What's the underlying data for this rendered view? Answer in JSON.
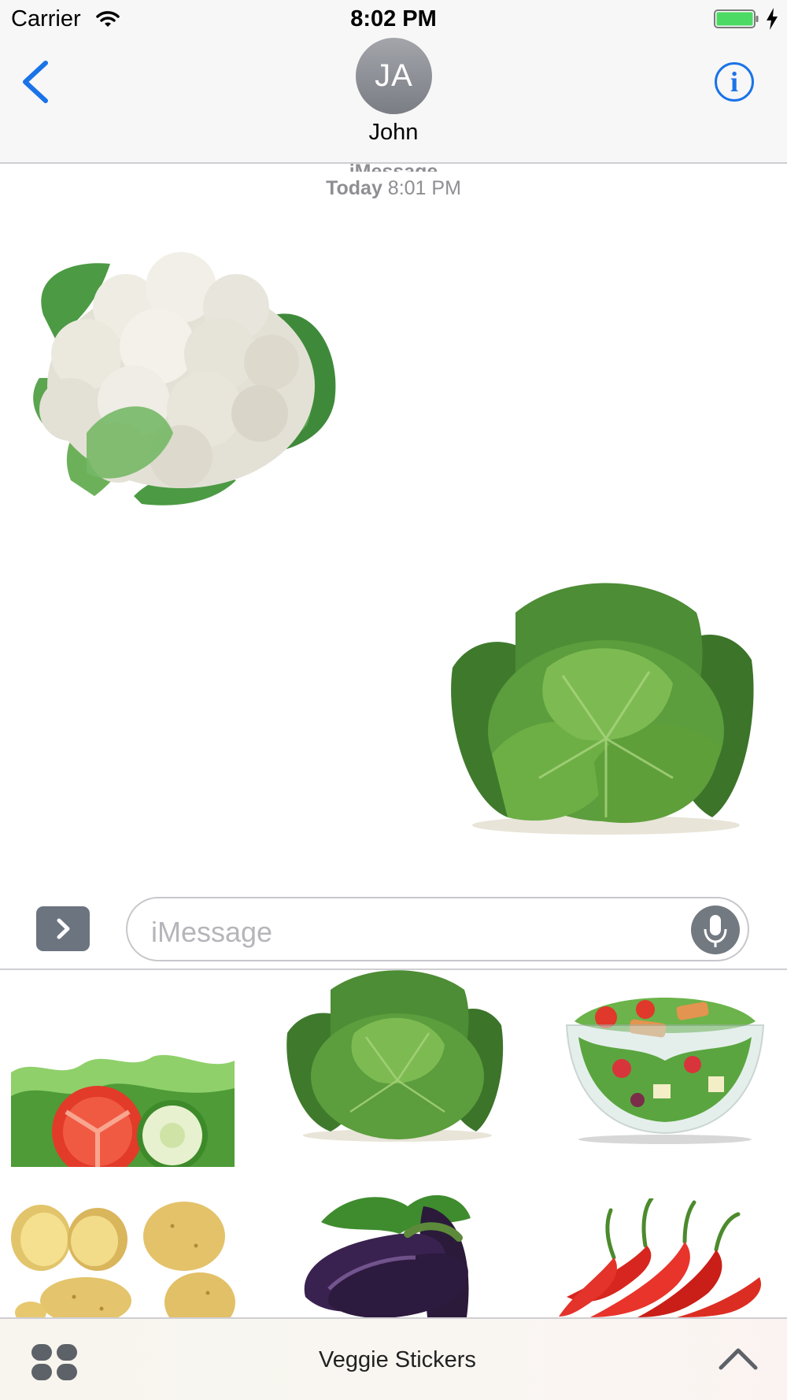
{
  "status_bar": {
    "carrier": "Carrier",
    "time": "8:02 PM",
    "battery_color": "#4cd964"
  },
  "header": {
    "avatar_initials": "JA",
    "contact_name": "John",
    "info_glyph": "i",
    "accent_color": "#1a73e8",
    "back_icon": "chevron-left-icon",
    "info_icon": "info-circle-icon"
  },
  "conversation": {
    "service_label": "iMessage",
    "timestamp_day": "Today",
    "timestamp_time": "8:01 PM",
    "messages": [
      {
        "sender": "contact",
        "sticker": "cauliflower"
      },
      {
        "sender": "me",
        "sticker": "savoy-cabbage"
      }
    ]
  },
  "composer": {
    "placeholder": "iMessage",
    "apps_icon": "chevron-right-icon",
    "mic_icon": "microphone-icon"
  },
  "sticker_drawer": {
    "items": [
      "lettuce-tomato-cucumber",
      "savoy-cabbage",
      "salad-bowl",
      "potatoes",
      "eggplants",
      "red-chili-peppers"
    ]
  },
  "bottom_bar": {
    "app_name": "Veggie Stickers",
    "drawer_icon": "app-grid-icon",
    "expand_icon": "chevron-up-icon"
  }
}
